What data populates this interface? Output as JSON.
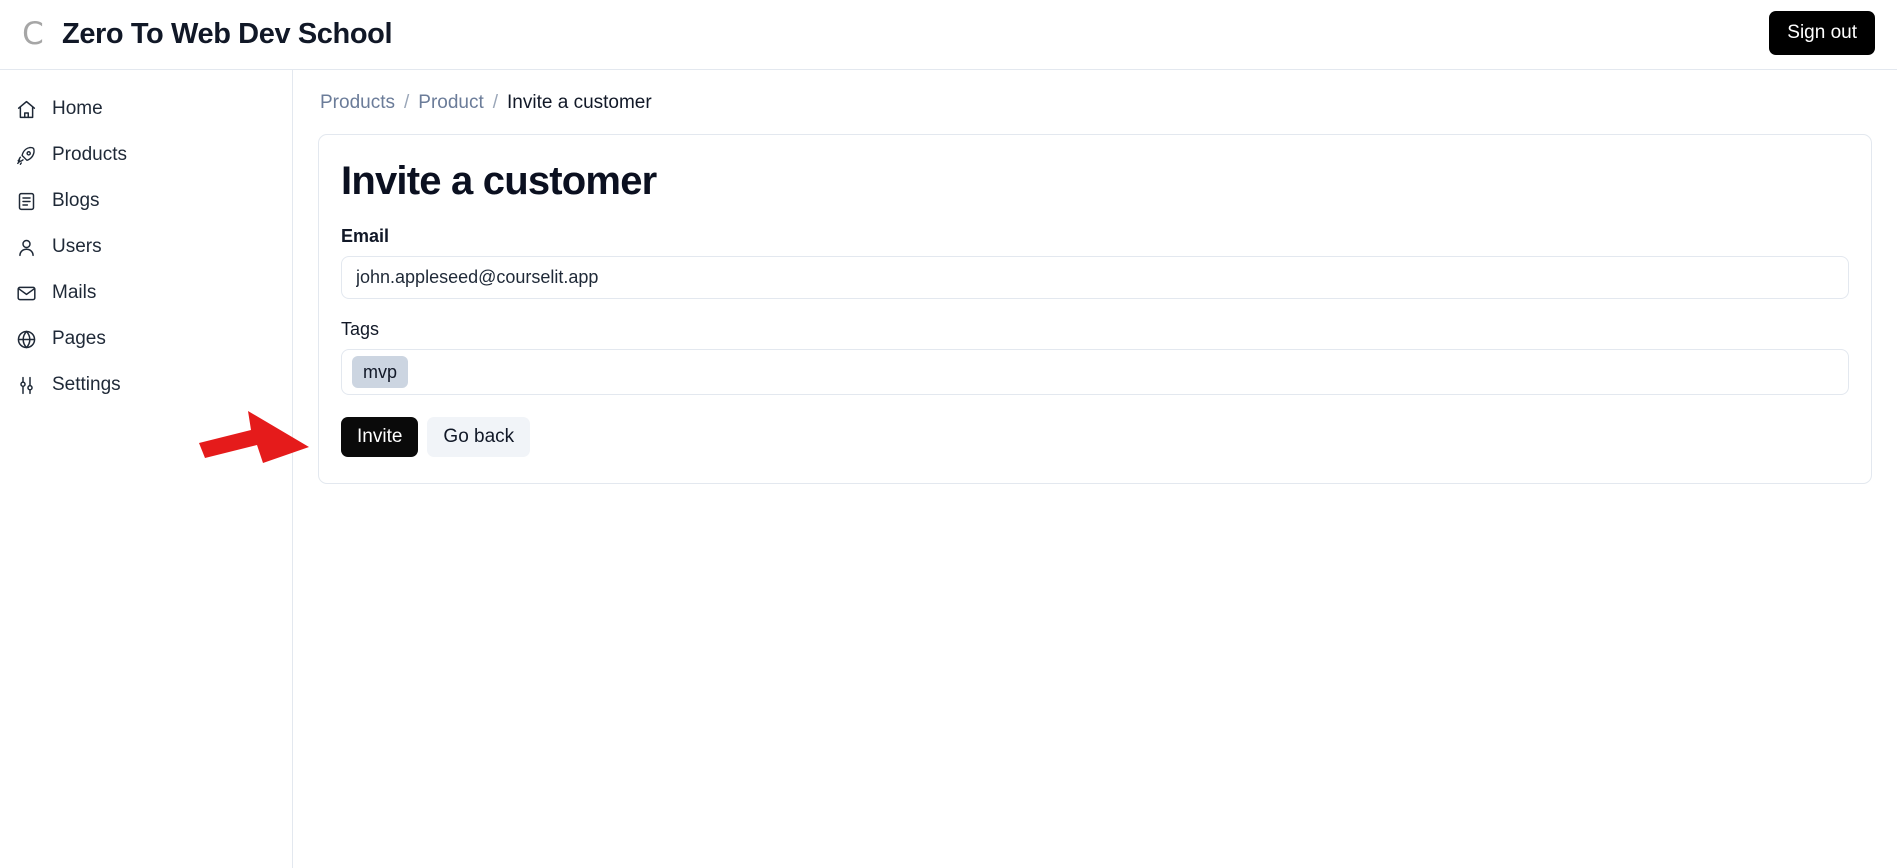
{
  "header": {
    "logo_icon": "courselit-c-logo-icon",
    "logo_letter": "C",
    "title": "Zero To Web Dev School",
    "signout_label": "Sign out"
  },
  "sidebar": {
    "items": [
      {
        "label": "Home",
        "icon": "home-icon"
      },
      {
        "label": "Products",
        "icon": "rocket-icon"
      },
      {
        "label": "Blogs",
        "icon": "document-icon"
      },
      {
        "label": "Users",
        "icon": "user-icon"
      },
      {
        "label": "Mails",
        "icon": "envelope-icon"
      },
      {
        "label": "Pages",
        "icon": "globe-icon"
      },
      {
        "label": "Settings",
        "icon": "sliders-icon"
      }
    ]
  },
  "breadcrumb": {
    "items": [
      {
        "label": "Products",
        "current": false
      },
      {
        "label": "Product",
        "current": false
      },
      {
        "label": "Invite a customer",
        "current": true
      }
    ],
    "separator": "/"
  },
  "main": {
    "page_title": "Invite a customer",
    "email_field": {
      "label": "Email",
      "value": "john.appleseed@courselit.app",
      "placeholder": "Email"
    },
    "tags_field": {
      "label": "Tags",
      "chips": [
        "mvp"
      ],
      "placeholder": ""
    },
    "invite_button": "Invite",
    "goback_button": "Go back"
  },
  "annotation": {
    "arrow_icon": "red-pointer-arrow-icon",
    "arrow_color": "#e51b1b",
    "points_at": "Invite"
  },
  "colors": {
    "accent_black": "#0a0a0a",
    "border": "#e3e8ef",
    "link": "#6b7c99",
    "chip_bg": "#ccd5e1",
    "text": "#111827"
  }
}
